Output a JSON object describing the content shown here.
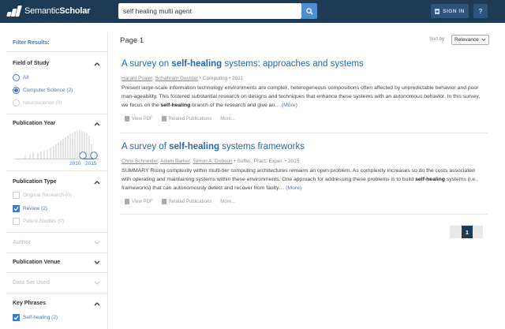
{
  "brand": {
    "name_light": "Semantic",
    "name_bold": "Scholar"
  },
  "search": {
    "query": "self healing multi agent"
  },
  "header": {
    "signin_label": "SIGN IN",
    "help_label": "?"
  },
  "colors": {
    "header_bg": "#1f3a55",
    "accent": "#4578b8",
    "link": "#2866a8"
  },
  "sidebar": {
    "title": "Filter Results:",
    "field_of_study": {
      "heading": "Field of Study",
      "options": [
        {
          "label": "All",
          "selected": false
        },
        {
          "label": "Computer Science (2)",
          "selected": true
        },
        {
          "label": "Neuroscience (0)",
          "selected": false,
          "disabled": true
        }
      ]
    },
    "publication_year": {
      "heading": "Publication Year",
      "start_label": "2010",
      "end_label": "2015"
    },
    "publication_type": {
      "heading": "Publication Type",
      "options": [
        {
          "label": "Original Research (0)",
          "checked": false
        },
        {
          "label": "Review (2)",
          "checked": true
        },
        {
          "label": "Patent Studies (0)",
          "checked": false
        }
      ]
    },
    "author": {
      "heading": "Author"
    },
    "publication_venue": {
      "heading": "Publication Venue"
    },
    "data_set_used": {
      "heading": "Data Set Used"
    },
    "key_phrases": {
      "heading": "Key Phrases",
      "options": [
        {
          "label": "Self-healing (2)",
          "checked": true
        }
      ]
    }
  },
  "main": {
    "page_label": "Page 1",
    "sort_label": "Sort by:",
    "sort_value": "Relevance",
    "results": [
      {
        "title_pre": "A survey on ",
        "title_bold": "self-healing",
        "title_post": " systems: approaches and systems",
        "authors": [
          "Harald Psaier",
          "Schahram Dustdar"
        ],
        "meta_rest": " • Computing • 2011",
        "abstract_1": "Present large-scale information technology environments are complex, heterogeneous compositions often affected by unpredictable behavior and poor man-ageability. This fostered substantial research on designs and techniques that enhance these systems with an autonomous behavior. In this survey, we focus on the ",
        "abstract_bold": "self-healing",
        "abstract_2": " branch of the research and give an…",
        "more_label": "(More)",
        "actions": [
          "View PDF",
          "Related Publications",
          "More..."
        ]
      },
      {
        "title_pre": "A survey of ",
        "title_bold": "self-healing",
        "title_post": " systems frameworks",
        "authors": [
          "Chris Schneider",
          "Adam Barker",
          "Simon A. Dobson"
        ],
        "meta_rest": " • Softw., Pract. Exper. • 2015",
        "abstract_1": "SUMMARY Rising complexity within multi-tier computing architectures remains an open problem. As complexity increases so do the costs associated with operating and maintaining systems within these environments. One approach for addressing these problems is to build ",
        "abstract_bold": "self-healing",
        "abstract_2": " systems (i.e., frameworks) that can autonomously detect and recover from faulty…",
        "more_label": "(More)",
        "actions": [
          "View PDF",
          "Related Publications",
          "More..."
        ]
      }
    ],
    "pagination": {
      "current": "1"
    }
  }
}
